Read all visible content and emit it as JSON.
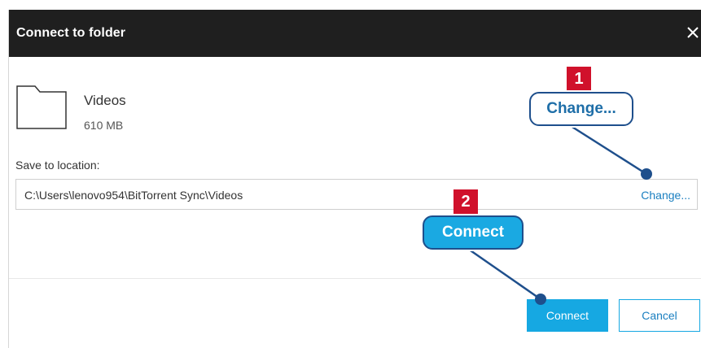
{
  "dialog": {
    "title": "Connect to folder",
    "close_icon": "close-icon"
  },
  "folder": {
    "icon": "folder-icon",
    "name": "Videos",
    "size": "610 MB"
  },
  "location": {
    "label": "Save to location:",
    "path": "C:\\Users\\lenovo954\\BitTorrent Sync\\Videos",
    "change_label": "Change..."
  },
  "buttons": {
    "connect_label": "Connect",
    "cancel_label": "Cancel"
  },
  "annotations": {
    "badge_1": "1",
    "callout_1": "Change...",
    "badge_2": "2",
    "callout_2": "Connect"
  },
  "colors": {
    "titlebar": "#1f1f1f",
    "accent": "#16a8e2",
    "link": "#1a7fc0",
    "badge": "#d0112b",
    "callout_border": "#1e4f8c"
  }
}
